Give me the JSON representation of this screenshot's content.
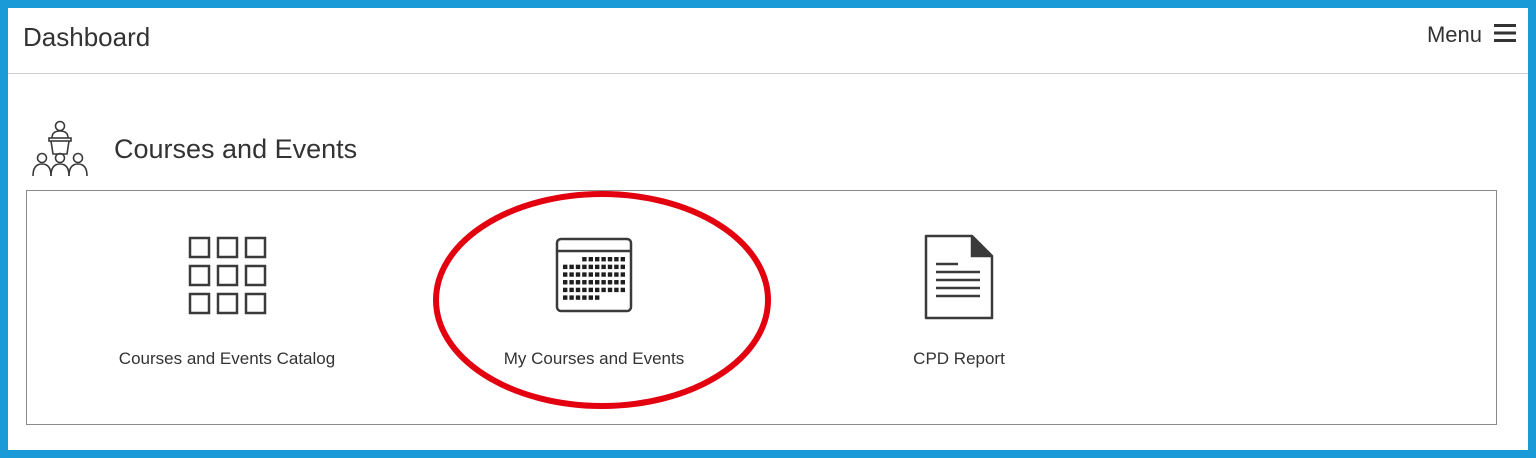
{
  "header": {
    "title": "Dashboard",
    "menu_label": "Menu",
    "menu_icon": "hamburger-icon"
  },
  "section": {
    "title": "Courses and Events",
    "icon": "presenter-audience-icon"
  },
  "tiles": [
    {
      "label": "Courses and Events Catalog",
      "icon": "grid-icon"
    },
    {
      "label": "My Courses and Events",
      "icon": "calendar-icon",
      "highlighted": true
    },
    {
      "label": "CPD Report",
      "icon": "document-icon"
    }
  ],
  "colors": {
    "frame_border": "#1a9bd7",
    "highlight_ring": "#e3000f",
    "text": "#333333",
    "icon": "#3a3a3a"
  }
}
